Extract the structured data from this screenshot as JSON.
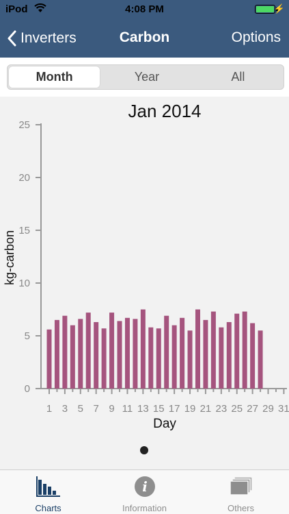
{
  "status_bar": {
    "carrier": "iPod",
    "time": "4:08 PM"
  },
  "nav": {
    "back_label": "Inverters",
    "title": "Carbon",
    "options_label": "Options"
  },
  "segments": [
    {
      "label": "Month",
      "active": true
    },
    {
      "label": "Year",
      "active": false
    },
    {
      "label": "All",
      "active": false
    }
  ],
  "tabs": [
    {
      "label": "Charts",
      "icon": "bar-chart-icon",
      "active": true
    },
    {
      "label": "Information",
      "icon": "info-icon",
      "active": false
    },
    {
      "label": "Others",
      "icon": "stack-icon",
      "active": false
    }
  ],
  "colors": {
    "nav_background": "#3b5a7e",
    "bar_color": "#a5547e",
    "active_tab": "#1a3f66"
  },
  "chart_data": {
    "type": "bar",
    "title": "Jan 2014",
    "xlabel": "Day",
    "ylabel": "kg-carbon",
    "ylim": [
      0,
      25
    ],
    "yticks": [
      0,
      5,
      10,
      15,
      20,
      25
    ],
    "xticks": [
      1,
      3,
      5,
      7,
      9,
      11,
      13,
      15,
      17,
      19,
      21,
      23,
      25,
      27,
      29,
      31
    ],
    "days": 31,
    "categories": [
      1,
      2,
      3,
      4,
      5,
      6,
      7,
      8,
      9,
      10,
      11,
      12,
      13,
      14,
      15,
      16,
      17,
      18,
      19,
      20,
      21,
      22,
      23,
      24,
      25,
      26,
      27,
      28,
      29,
      30,
      31
    ],
    "values": [
      5.6,
      6.5,
      6.9,
      6.0,
      6.6,
      7.2,
      6.3,
      5.7,
      7.2,
      6.4,
      6.7,
      6.6,
      7.5,
      5.8,
      5.7,
      6.9,
      6.0,
      6.7,
      5.5,
      7.5,
      6.5,
      7.3,
      5.8,
      6.3,
      7.1,
      7.3,
      6.2,
      5.5,
      null,
      null,
      null
    ]
  }
}
